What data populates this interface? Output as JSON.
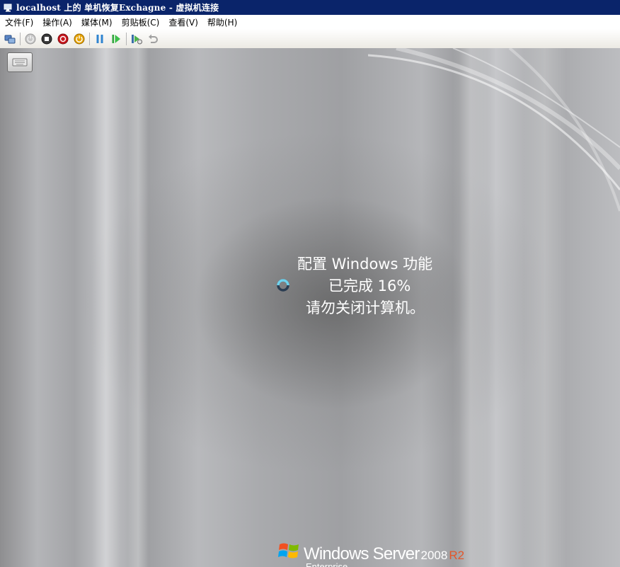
{
  "window": {
    "title": "localhost 上的 单机恢复Exchagne - 虚拟机连接"
  },
  "menu": {
    "items": [
      {
        "label": "文件(F)"
      },
      {
        "label": "操作(A)"
      },
      {
        "label": "媒体(M)"
      },
      {
        "label": "剪贴板(C)"
      },
      {
        "label": "查看(V)"
      },
      {
        "label": "帮助(H)"
      }
    ]
  },
  "toolbar": {
    "buttons": [
      {
        "name": "ctrl-alt-del-icon"
      },
      {
        "name": "start-icon"
      },
      {
        "name": "turn-off-icon"
      },
      {
        "name": "shut-down-icon"
      },
      {
        "name": "power-icon"
      },
      {
        "name": "pause-icon"
      },
      {
        "name": "resume-icon"
      },
      {
        "name": "snapshot-icon"
      },
      {
        "name": "revert-icon"
      }
    ]
  },
  "vm_screen": {
    "status_line1": "配置 Windows 功能",
    "status_line2": "已完成 16%",
    "status_line3": "请勿关闭计算机。",
    "progress_percent": 16,
    "brand": {
      "windows_server": "Windows Server",
      "version": "2008",
      "release": "R2",
      "edition": "Enterprise"
    }
  },
  "colors": {
    "titlebar": "#0a246a",
    "brand_r2": "#e2572c"
  }
}
